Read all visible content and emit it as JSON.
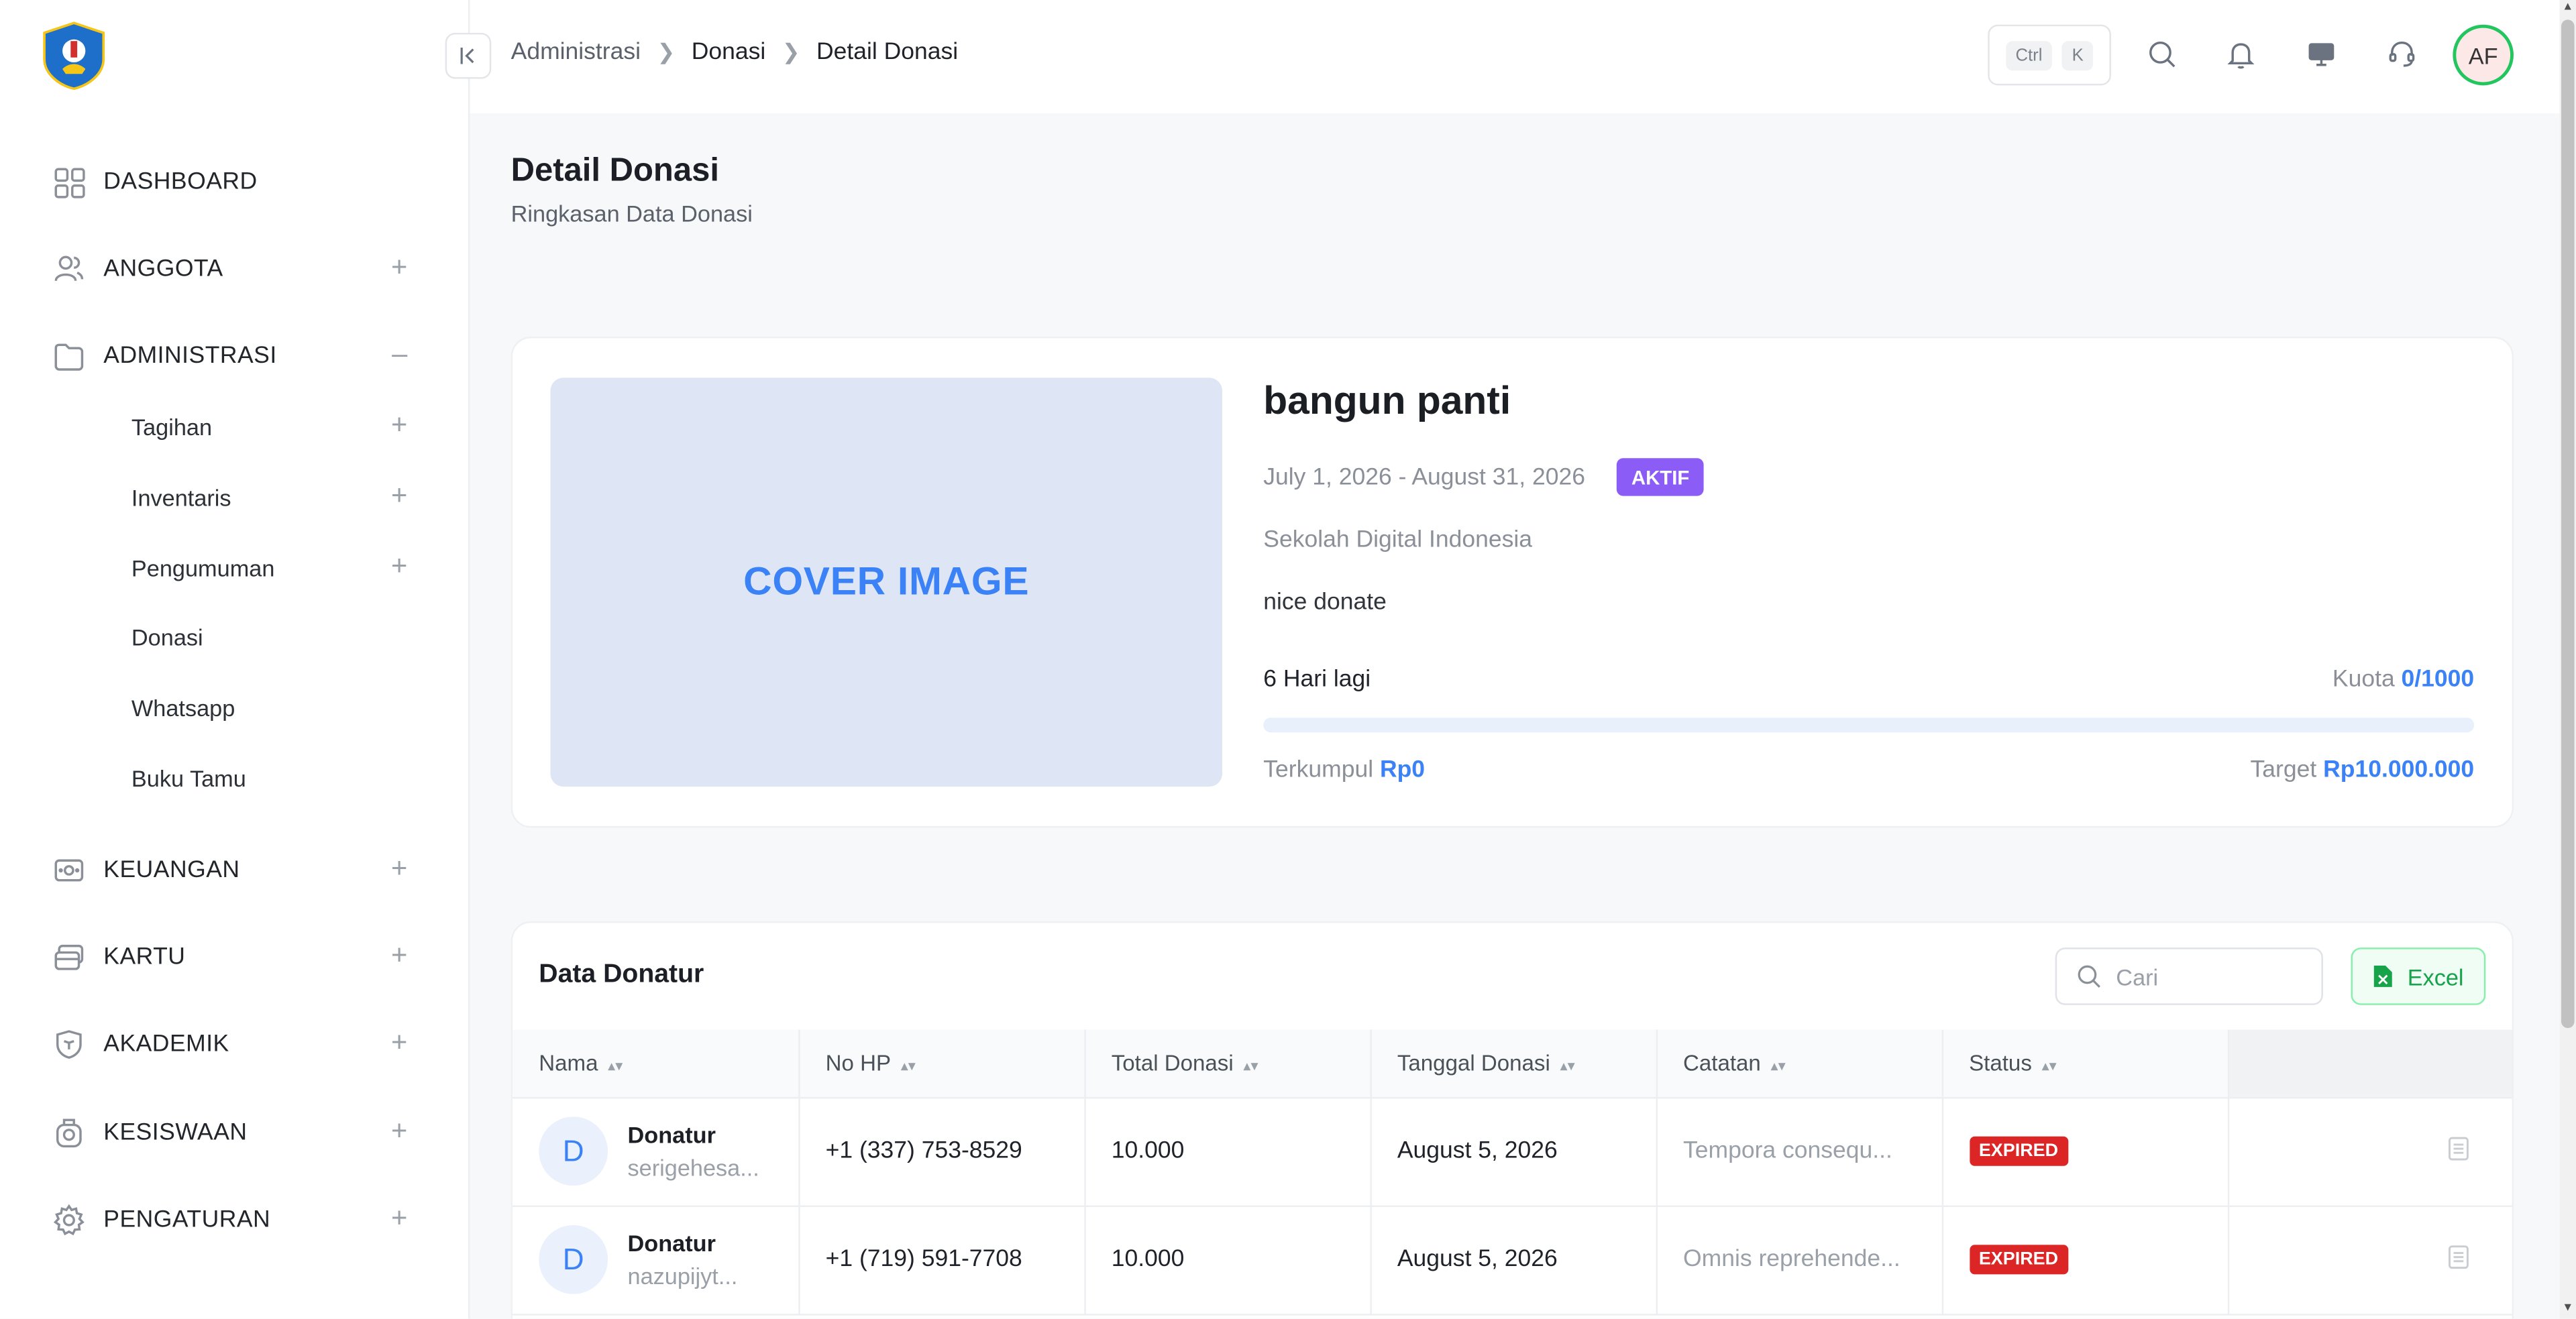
{
  "sidebar": {
    "items": [
      {
        "label": "DASHBOARD",
        "icon": "grid-icon"
      },
      {
        "label": "ANGGOTA",
        "icon": "users-icon"
      },
      {
        "label": "ADMINISTRASI",
        "icon": "folder-icon"
      },
      {
        "label": "KEUANGAN",
        "icon": "cash-icon"
      },
      {
        "label": "KARTU",
        "icon": "card-icon"
      },
      {
        "label": "AKADEMIK",
        "icon": "shield-book-icon"
      },
      {
        "label": "KESISWAAN",
        "icon": "student-icon"
      },
      {
        "label": "PENGATURAN",
        "icon": "gear-icon"
      }
    ],
    "subitems": [
      {
        "label": "Tagihan"
      },
      {
        "label": "Inventaris"
      },
      {
        "label": "Pengumuman"
      },
      {
        "label": "Donasi"
      },
      {
        "label": "Whatsapp"
      },
      {
        "label": "Buku Tamu"
      }
    ],
    "plus": "+",
    "minus": "–"
  },
  "header": {
    "breadcrumb": [
      "Administrasi",
      "Donasi",
      "Detail Donasi"
    ],
    "shortcut": [
      "Ctrl",
      "K"
    ],
    "avatar": "AF"
  },
  "page": {
    "title": "Detail Donasi",
    "subtitle": "Ringkasan Data Donasi"
  },
  "donation": {
    "cover_label": "COVER IMAGE",
    "title": "bangun panti",
    "dates": "July 1, 2026 - August 31, 2026",
    "status": "AKTIF",
    "organization": "Sekolah Digital Indonesia",
    "description": "nice donate",
    "days_left": "6 Hari lagi",
    "quota_label": "Kuota",
    "quota_value": "0/1000",
    "collected_label": "Terkumpul",
    "collected_value": "Rp0",
    "target_label": "Target",
    "target_value": "Rp10.000.000",
    "progress_percent": 0
  },
  "donors": {
    "title": "Data Donatur",
    "search_placeholder": "Cari",
    "excel_label": "Excel",
    "columns": [
      "Nama",
      "No HP",
      "Total Donasi",
      "Tanggal Donasi",
      "Catatan",
      "Status"
    ],
    "rows": [
      {
        "initial": "D",
        "name": "Donatur",
        "email": "serigehesa...",
        "phone": "+1 (337) 753-8529",
        "total": "10.000",
        "date": "August 5, 2026",
        "note": "Tempora consequ...",
        "status": "EXPIRED"
      },
      {
        "initial": "D",
        "name": "Donatur",
        "email": "nazupijyt...",
        "phone": "+1 (719) 591-7708",
        "total": "10.000",
        "date": "August 5, 2026",
        "note": "Omnis reprehende...",
        "status": "EXPIRED"
      }
    ]
  },
  "colors": {
    "accent": "#3b82f6",
    "status_active": "#8b5cf6",
    "status_expired": "#dc2626",
    "excel_green": "#16a34a"
  }
}
